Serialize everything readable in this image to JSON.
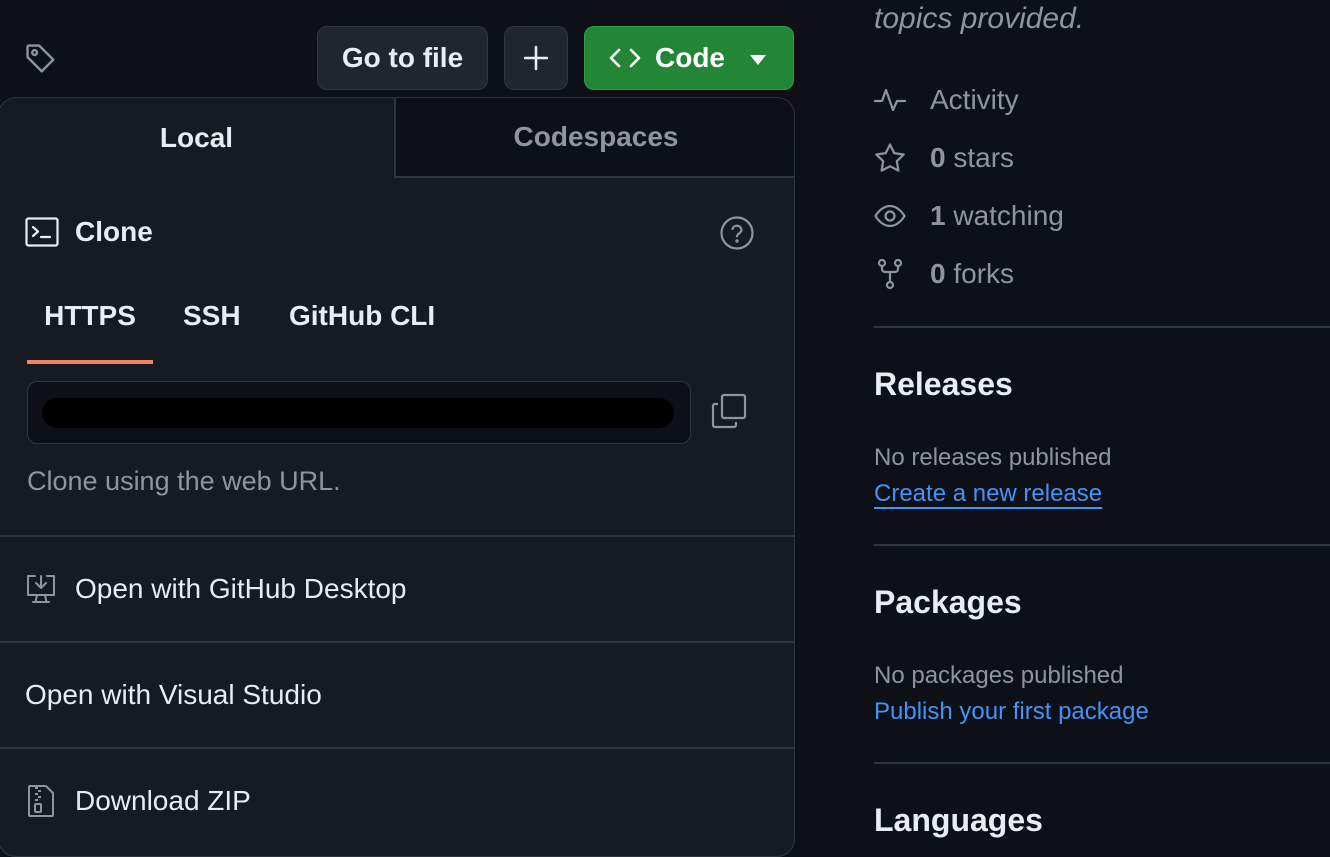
{
  "toolbar": {
    "tag_icon": "tag-icon",
    "go_to_file": "Go to file",
    "add_file_icon": "plus-icon",
    "code_label": "Code",
    "code_icon": "code-icon",
    "code_caret_icon": "triangle-down-icon"
  },
  "dropdown": {
    "tabs": [
      {
        "label": "Local",
        "selected": true
      },
      {
        "label": "Codespaces",
        "selected": false
      }
    ],
    "clone": {
      "icon": "terminal-icon",
      "title": "Clone",
      "help_icon": "question-icon",
      "protocols": [
        {
          "label": "HTTPS",
          "selected": true
        },
        {
          "label": "SSH",
          "selected": false
        },
        {
          "label": "GitHub CLI",
          "selected": false
        }
      ],
      "url_value": "",
      "copy_icon": "copy-icon",
      "hint": "Clone using the web URL."
    },
    "actions": [
      {
        "label": "Open with GitHub Desktop",
        "icon": "desktop-download-icon"
      },
      {
        "label": "Open with Visual Studio",
        "icon": ""
      },
      {
        "label": "Download ZIP",
        "icon": "file-zip-icon"
      }
    ]
  },
  "sidebar": {
    "topics_text": "topics provided.",
    "stats": [
      {
        "icon": "pulse-icon",
        "count": "",
        "label": "Activity"
      },
      {
        "icon": "star-icon",
        "count": "0",
        "label": "stars"
      },
      {
        "icon": "eye-icon",
        "count": "1",
        "label": "watching"
      },
      {
        "icon": "repo-forked-icon",
        "count": "0",
        "label": "forks"
      }
    ],
    "releases": {
      "heading": "Releases",
      "empty_text": "No releases published",
      "link": "Create a new release"
    },
    "packages": {
      "heading": "Packages",
      "empty_text": "No packages published",
      "link": "Publish your first package"
    },
    "languages": {
      "heading": "Languages"
    }
  },
  "colors": {
    "background": "#0d1117",
    "panel": "#161b22",
    "border": "#30363d",
    "code_button": "#238636",
    "tab_underline": "#f78166",
    "link": "#4493f8",
    "muted_text": "#8d96a0"
  }
}
